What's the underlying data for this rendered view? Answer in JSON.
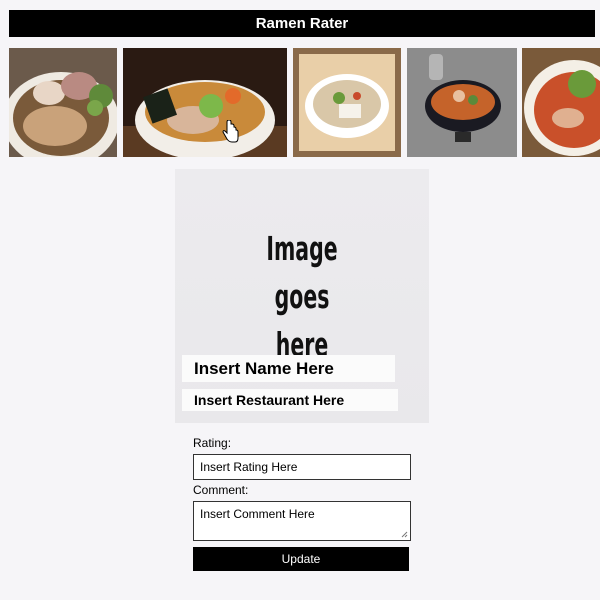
{
  "header": {
    "title": "Ramen Rater"
  },
  "gallery": {
    "items": [
      {
        "icon": "ramen-bowl-image"
      },
      {
        "icon": "ramen-bowl-image"
      },
      {
        "icon": "ramen-bowl-image"
      },
      {
        "icon": "ramen-bowl-image"
      },
      {
        "icon": "ramen-bowl-image"
      }
    ]
  },
  "detail": {
    "image_placeholder": {
      "line1": "Image",
      "line2": "goes",
      "line3": "here"
    },
    "name": "Insert Name Here",
    "restaurant": "Insert Restaurant Here"
  },
  "form": {
    "rating_label": "Rating:",
    "rating_value": "Insert Rating Here",
    "comment_label": "Comment:",
    "comment_value": "Insert Comment Here",
    "update_label": "Update"
  },
  "colors": {
    "header_bg": "#000000",
    "button_bg": "#000000",
    "page_bg": "#f6f5f8"
  }
}
